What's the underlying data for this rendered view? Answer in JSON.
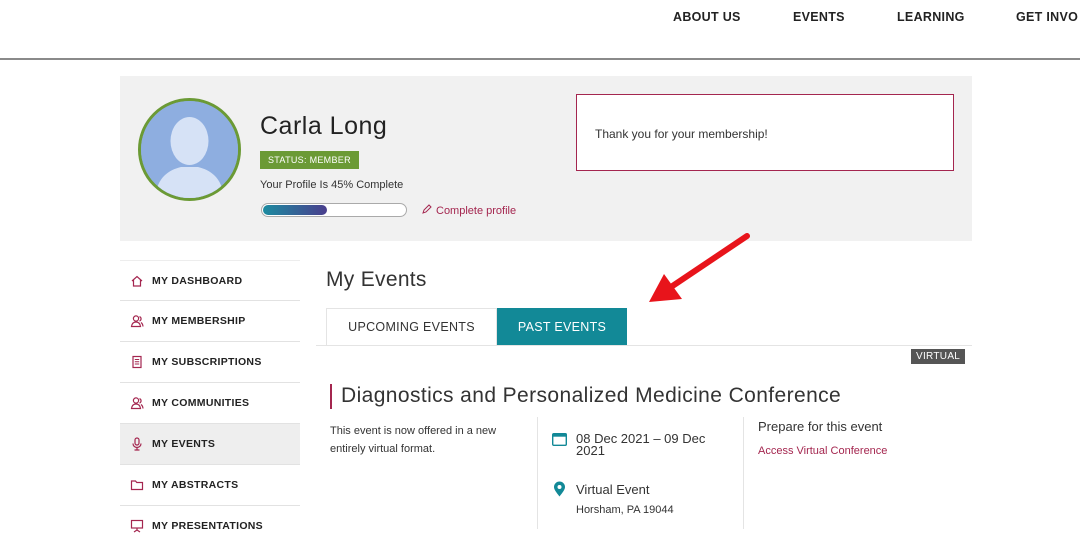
{
  "nav": {
    "items": [
      {
        "label": "ABOUT US"
      },
      {
        "label": "EVENTS"
      },
      {
        "label": "LEARNING"
      },
      {
        "label": "GET INVO"
      }
    ]
  },
  "profile": {
    "name": "Carla Long",
    "status": "STATUS: MEMBER",
    "completion_text": "Your Profile Is 45% Complete",
    "completion_percent": 45,
    "complete_link": "Complete profile",
    "message": "Thank you for your membership!"
  },
  "sidebar": {
    "items": [
      {
        "label": "MY DASHBOARD",
        "icon": "home-icon"
      },
      {
        "label": "MY MEMBERSHIP",
        "icon": "users-icon"
      },
      {
        "label": "MY SUBSCRIPTIONS",
        "icon": "document-icon"
      },
      {
        "label": "MY COMMUNITIES",
        "icon": "users-icon"
      },
      {
        "label": "MY EVENTS",
        "icon": "microphone-icon",
        "active": true
      },
      {
        "label": "MY ABSTRACTS",
        "icon": "folder-icon"
      },
      {
        "label": "MY PRESENTATIONS",
        "icon": "presentation-icon"
      }
    ]
  },
  "main": {
    "title": "My Events",
    "tabs": [
      {
        "label": "UPCOMING EVENTS"
      },
      {
        "label": "PAST EVENTS",
        "active": true
      }
    ]
  },
  "event": {
    "badge": "VIRTUAL",
    "title": "Diagnostics and Personalized Medicine Conference",
    "description": "This event is now offered in a new entirely virtual format.",
    "date": "08 Dec 2021 – 09 Dec 2021",
    "location": "Virtual Event",
    "address": "Horsham, PA 19044",
    "prepare_heading": "Prepare for this event",
    "access_link": "Access Virtual Conference"
  },
  "colors": {
    "accent": "#a4264f",
    "teal": "#128997",
    "status_green": "#6b9a35",
    "annotation_red": "#e8141b"
  }
}
